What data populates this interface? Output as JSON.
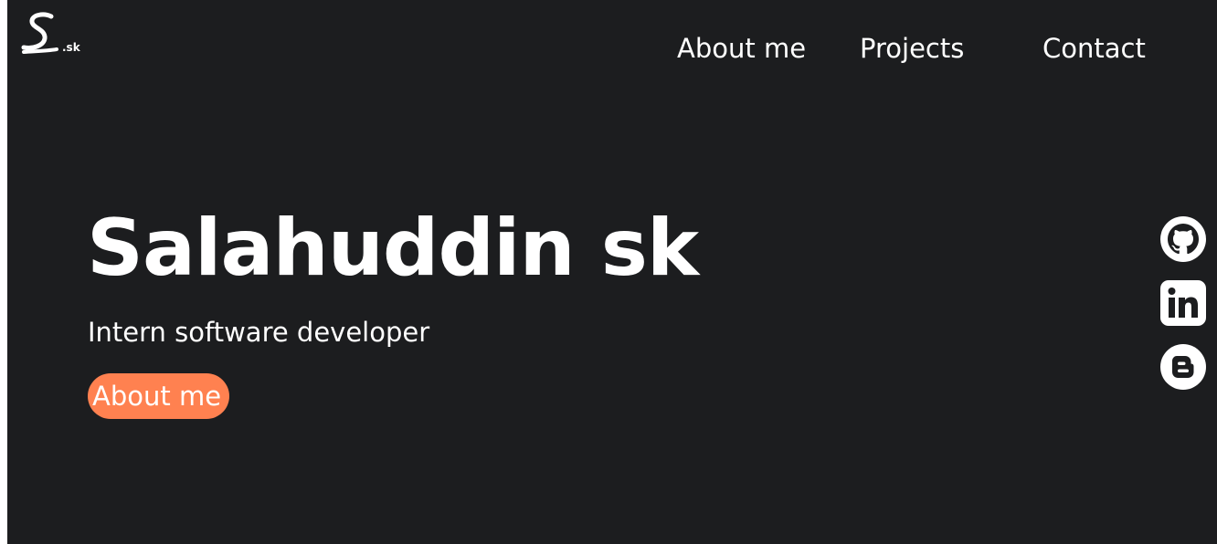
{
  "logo": {
    "suffix": ".sk",
    "icon": "signature-s-logo"
  },
  "nav": {
    "about": "About me",
    "projects": "Projects",
    "contact": "Contact"
  },
  "hero": {
    "title": "Salahuddin sk",
    "subtitle": "Intern software developer",
    "button": "About me"
  },
  "social": [
    {
      "icon": "github-icon"
    },
    {
      "icon": "linkedin-icon"
    },
    {
      "icon": "blogger-icon"
    }
  ],
  "colors": {
    "background": "#1c1d1f",
    "text": "#ffffff",
    "accent": "#ff8150"
  }
}
